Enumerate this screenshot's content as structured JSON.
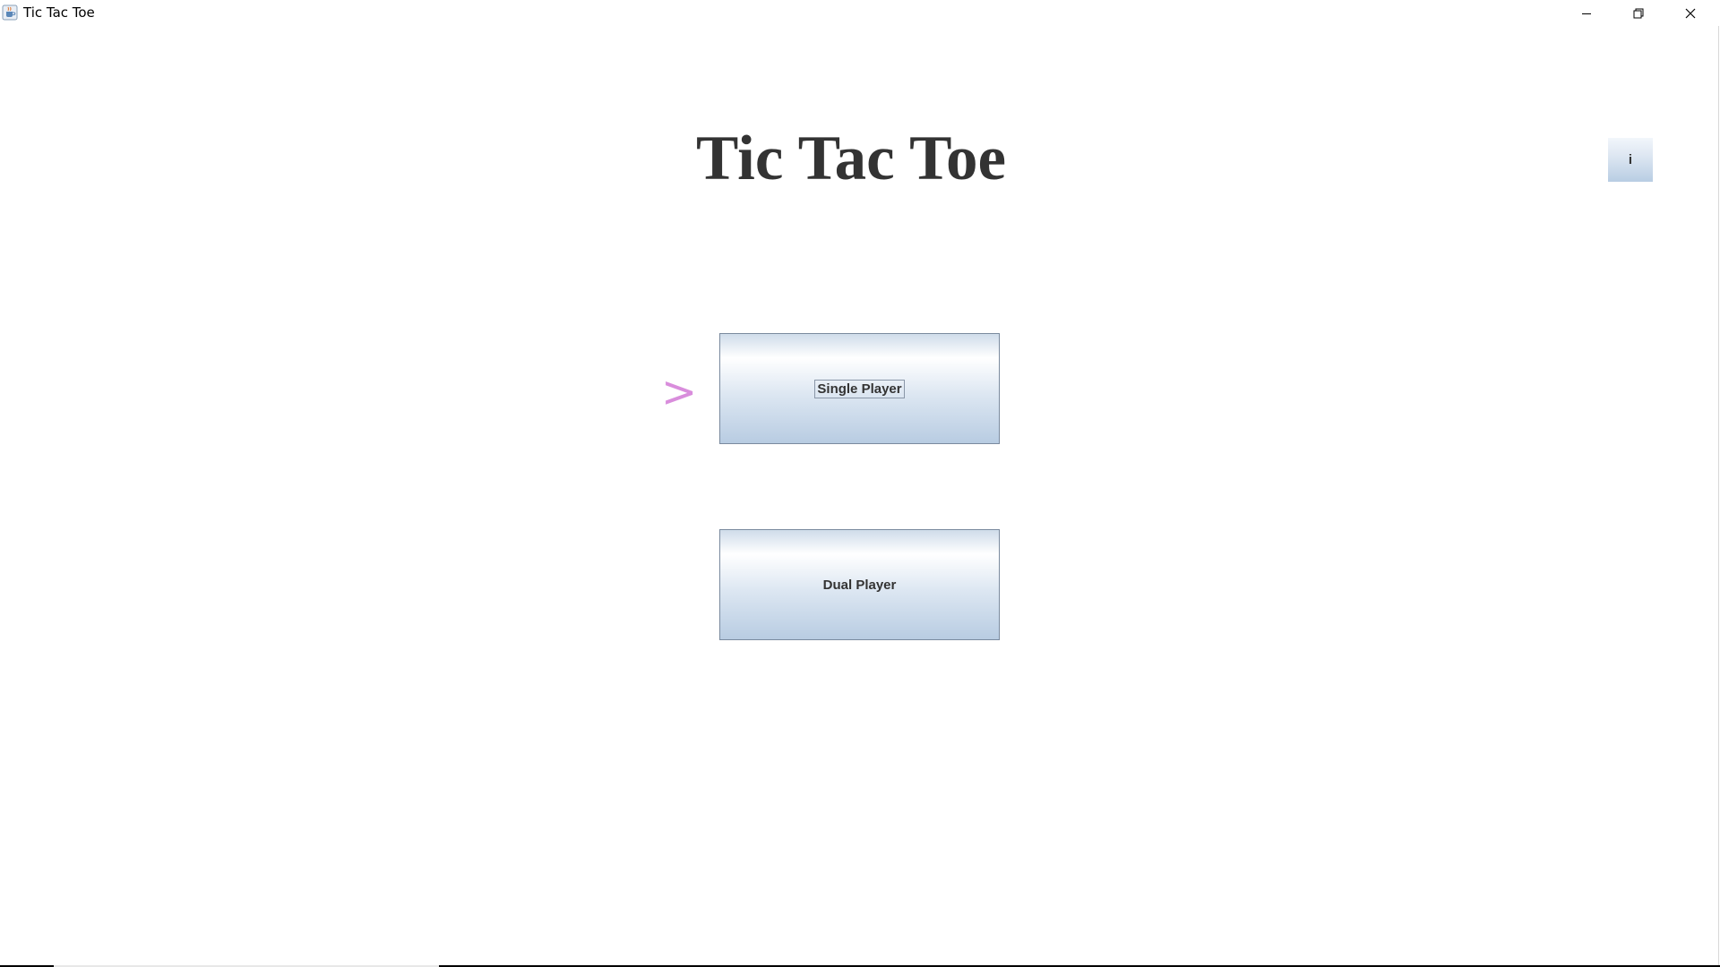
{
  "window": {
    "title": "Tic Tac Toe",
    "icon": "java-cup-icon",
    "controls": {
      "minimize_icon": "minimize-icon",
      "restore_icon": "restore-icon",
      "close_icon": "close-icon"
    }
  },
  "main": {
    "title": "Tic Tac Toe",
    "info_label": "i",
    "pointer_glyph": ">",
    "pointer_color": "#d98ddc",
    "buttons": [
      {
        "label": "Single Player",
        "focused": true
      },
      {
        "label": "Dual Player",
        "focused": false
      }
    ]
  },
  "colors": {
    "title_text": "#333333",
    "button_gradient_top": "#ffffff",
    "button_gradient_bottom": "#b8cce2",
    "button_border": "#7a8a9e"
  }
}
